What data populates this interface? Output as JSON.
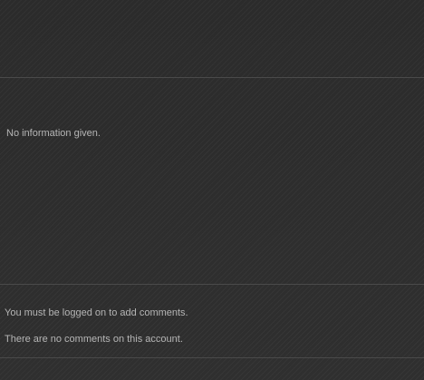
{
  "profile": {
    "info_text": "No information given."
  },
  "comments": {
    "login_notice": "You must be logged on to add comments.",
    "empty_notice": "There are no comments on this account."
  }
}
